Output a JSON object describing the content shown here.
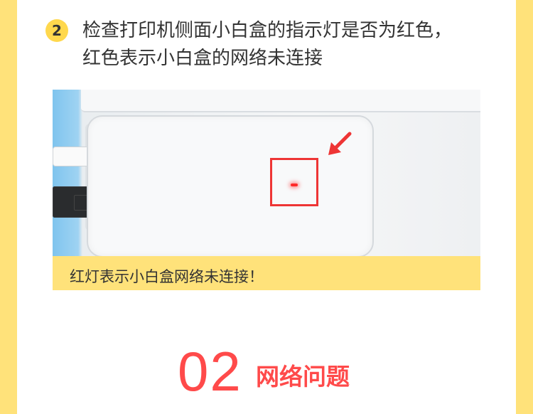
{
  "step": {
    "number": "2",
    "line1": "检查打印机侧面小白盒的指示灯是否为红色，",
    "line2": "红色表示小白盒的网络未连接"
  },
  "photo": {
    "caption": "红灯表示小白盒网络未连接！",
    "led_color": "#ff2a2a",
    "highlight_color": "#ee3535"
  },
  "section": {
    "number": "02",
    "title": "网络问题"
  },
  "colors": {
    "background": "#ffe27a",
    "accent": "#ff4a4a",
    "badge": "#ffd84d"
  }
}
